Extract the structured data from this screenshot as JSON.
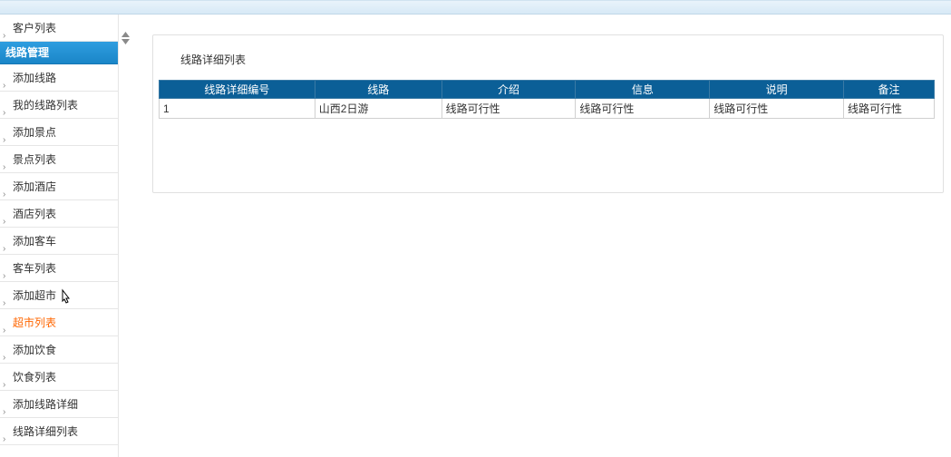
{
  "sidebar": {
    "top_item": "客户列表",
    "group": "线路管理",
    "items": [
      "添加线路",
      "我的线路列表",
      "添加景点",
      "景点列表",
      "添加酒店",
      "酒店列表",
      "添加客车",
      "客车列表",
      "添加超市",
      "超市列表",
      "添加饮食",
      "饮食列表",
      "添加线路详细",
      "线路详细列表"
    ],
    "active_index": 9
  },
  "main": {
    "panel_title": "线路详细列表",
    "table": {
      "headers": [
        "线路详细编号",
        "线路",
        "介绍",
        "信息",
        "说明",
        "备注"
      ],
      "rows": [
        [
          "1",
          "山西2日游",
          "线路可行性",
          "线路可行性",
          "线路可行性",
          "线路可行性"
        ]
      ]
    }
  }
}
